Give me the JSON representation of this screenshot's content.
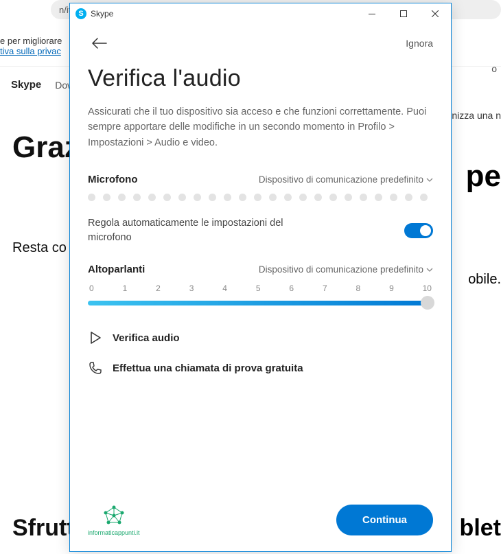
{
  "background": {
    "url_fragment": "n/it/thank-you",
    "cookie_text": "e per migliorare",
    "cookie_link": "tiva sulla privac",
    "nav_brand": "Skype",
    "nav_item": "Dow",
    "h1_left": "Graz",
    "h1_right": "pe",
    "p_left": "Resta co",
    "p_right": "obile.",
    "right_text": "nizza una n",
    "right_o": "o",
    "h2_left": "Sfrutta",
    "h2_right": "blet"
  },
  "titlebar": {
    "app_name": "Skype"
  },
  "header": {
    "ignore_label": "Ignora"
  },
  "main": {
    "title": "Verifica l'audio",
    "description": "Assicurati che il tuo dispositivo sia acceso e che funzioni correttamente. Puoi sempre apportare delle modifiche in un secondo momento in Profilo > Impostazioni > Audio e video."
  },
  "microphone": {
    "label": "Microfono",
    "device": "Dispositivo di comunicazione predefinito",
    "auto_adjust_label": "Regola automaticamente le impostazioni del microfono",
    "auto_adjust_on": true
  },
  "speakers": {
    "label": "Altoparlanti",
    "device": "Dispositivo di comunicazione predefinito",
    "ticks": [
      "0",
      "1",
      "2",
      "3",
      "4",
      "5",
      "6",
      "7",
      "8",
      "9",
      "10"
    ],
    "value": 10
  },
  "actions": {
    "test_audio": "Verifica audio",
    "test_call": "Effettua una chiamata di prova gratuita"
  },
  "footer": {
    "watermark": "informaticappunti.it",
    "continue_label": "Continua"
  }
}
